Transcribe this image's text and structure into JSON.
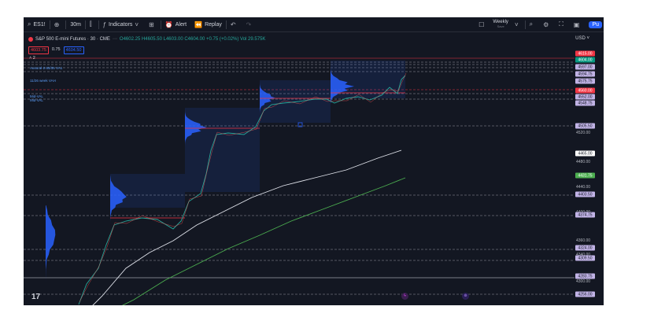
{
  "toolbar": {
    "symbol": "ES1!",
    "interval": "30m",
    "indicators_label": "Indicators",
    "alert_label": "Alert",
    "replay_label": "Replay",
    "layout_name": "Weekly",
    "layout_sub": "Save",
    "publish_label": "Pu"
  },
  "legend": {
    "title": "S&P 500 E-mini Futures · 30 · CME",
    "ohlc": "O4602.25 H4605.50 L4603.00 C4604.00 +0.75 (+0.02%) Vol 29.575K"
  },
  "order": {
    "sell_price": "4603.75",
    "spread": "0.75",
    "buy_price": "4604.50"
  },
  "collapse_label": "˄ 2",
  "indicator_labels": [
    "Ausoral-2.65/35 VA1",
    "11/26 week VAH",
    "Mid-VAL",
    "Mid-VAL"
  ],
  "currency": "USD",
  "axis_ticks": [
    "4520.00",
    "4480.00",
    "4440.00",
    "4400.00",
    "4360.00",
    "4340.00",
    "4300.00"
  ],
  "price_labels": [
    {
      "text": "4615.00",
      "bg": "#f23645",
      "fg": "#ffffff"
    },
    {
      "text": "4604.00",
      "bg": "#089981",
      "fg": "#ffffff"
    },
    {
      "text": "4597.00",
      "bg": "#c1b3e6",
      "fg": "#131722"
    },
    {
      "text": "4594.75",
      "bg": "#c1b3e6",
      "fg": "#131722"
    },
    {
      "text": "4575.75",
      "bg": "#c1b3e6",
      "fg": "#131722"
    },
    {
      "text": "4560.00",
      "bg": "#f23645",
      "fg": "#ffffff"
    },
    {
      "text": "4552.00",
      "bg": "#c1b3e6",
      "fg": "#131722"
    },
    {
      "text": "4548.75",
      "bg": "#c1b3e6",
      "fg": "#131722"
    },
    {
      "text": "4505.50",
      "bg": "#c1b3e6",
      "fg": "#131722"
    },
    {
      "text": "4465.00",
      "bg": "#ffffff",
      "fg": "#131722"
    },
    {
      "text": "4431.75",
      "bg": "#4caf50",
      "fg": "#ffffff"
    },
    {
      "text": "4403.50",
      "bg": "#c1b3e6",
      "fg": "#131722"
    },
    {
      "text": "4374.75",
      "bg": "#c1b3e6",
      "fg": "#131722"
    },
    {
      "text": "4324.00",
      "bg": "#c1b3e6",
      "fg": "#131722"
    },
    {
      "text": "4309.50",
      "bg": "#c1b3e6",
      "fg": "#131722"
    },
    {
      "text": "4283.75",
      "bg": "#c1b3e6",
      "fg": "#131722"
    },
    {
      "text": "4256.00",
      "bg": "#c1b3e6",
      "fg": "#131722"
    }
  ],
  "colors": {
    "background": "#131722",
    "up": "#26a69a",
    "down": "#ef5350",
    "profile": "#2962ff",
    "white_line": "#e0e3eb",
    "green_line": "#4caf50"
  },
  "icons": {
    "logo": "tradingview-logo",
    "event1": "lightning-icon",
    "event2": "event-icon"
  }
}
